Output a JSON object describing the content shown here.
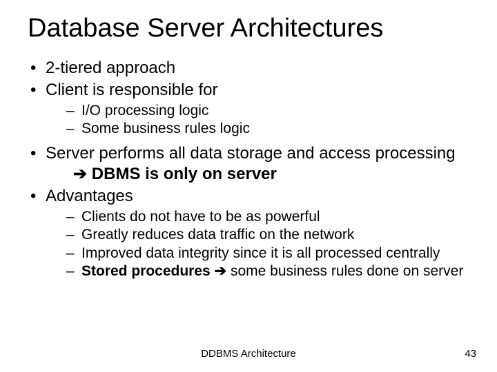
{
  "title": "Database Server Architectures",
  "bullets": {
    "b1": "2-tiered approach",
    "b2": "Client is responsible for",
    "b2_sub": {
      "s1": "I/O processing logic",
      "s2": "Some business rules logic"
    },
    "b3_a": "Server performs all data storage and access processing       ",
    "b3_arrow": "➔",
    "b3_b": " DBMS is only on server",
    "b4": "Advantages",
    "b4_sub": {
      "s1": "Clients do not have to be as powerful",
      "s2": "Greatly reduces data traffic on the network",
      "s3": "Improved data integrity since it is all processed centrally",
      "s4_a": "Stored procedures",
      "s4_arrow": " ➔ ",
      "s4_b": "some business rules done on server"
    }
  },
  "footer": {
    "center": "DDBMS Architecture",
    "page": "43"
  }
}
